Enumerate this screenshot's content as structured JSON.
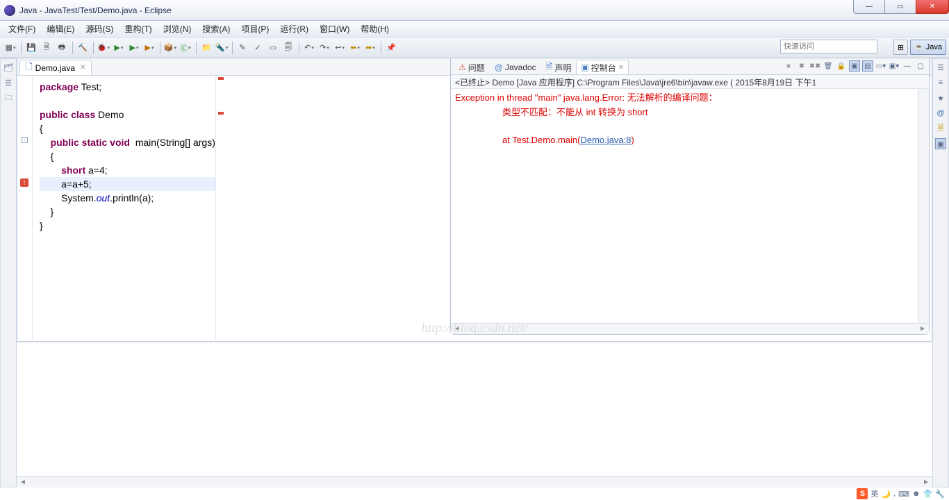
{
  "window": {
    "title": "Java  -  JavaTest/Test/Demo.java  -  Eclipse"
  },
  "menus": [
    "文件(F)",
    "编辑(E)",
    "源码(S)",
    "重构(T)",
    "浏览(N)",
    "搜索(A)",
    "项目(P)",
    "运行(R)",
    "窗口(W)",
    "帮助(H)"
  ],
  "quick_access_placeholder": "快速访问",
  "perspective": {
    "java_label": "Java"
  },
  "editor_tab": {
    "label": "Demo.java",
    "close": "✕"
  },
  "code": {
    "l1_pkg": "package",
    "l1_rest": " Test;",
    "l3_pub": "public",
    "l3_class": " class",
    "l3_name": " Demo",
    "l4": "{",
    "l5_pub": "public",
    "l5_static": " static",
    "l5_void": " void",
    "l5_rest": "  main(String[] args)",
    "l6": "    {",
    "l7_short": "short",
    "l7_rest": " a=4;",
    "l8": "        a=a+5;",
    "l9a": "        System.",
    "l9_out": "out",
    "l9b": ".println(a);",
    "l10": "    }",
    "l11": "}"
  },
  "rp_tabs": {
    "problems": "问题",
    "javadoc": "Javadoc",
    "decl": "声明",
    "console": "控制台",
    "close": "✕"
  },
  "console_status": "<已终止> Demo [Java 应用程序] C:\\Program Files\\Java\\jre6\\bin\\javaw.exe ( 2015年8月19日 下午1",
  "console": {
    "line1": "Exception in thread \"main\" java.lang.Error: 无法解析的编译问题：",
    "line2": "类型不匹配：不能从 int 转换为 short",
    "line3a": "at Test.Demo.main(",
    "line3_link": "Demo.java:8",
    "line3b": ")"
  },
  "watermark": "http://blog.csdn.net/",
  "taskbar": {
    "ime": "英"
  }
}
